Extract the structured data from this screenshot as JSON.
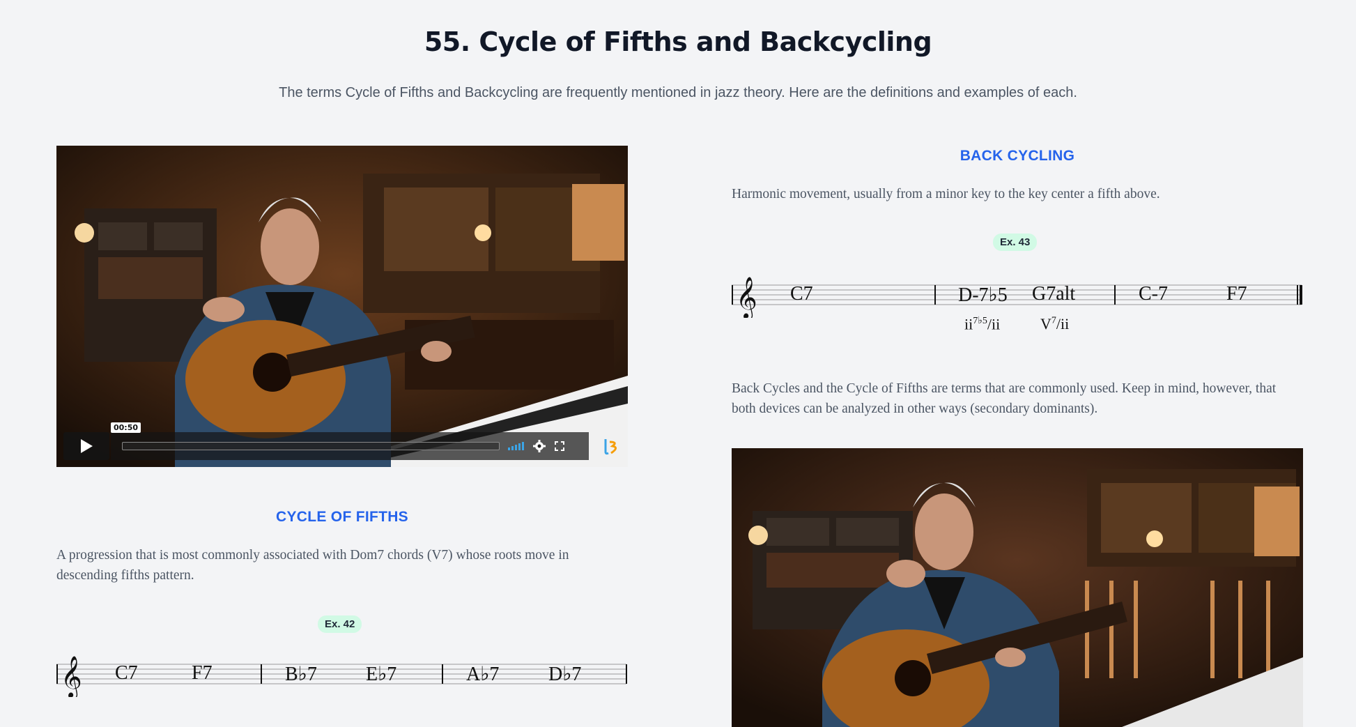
{
  "title": "55.  Cycle of Fifths and Backcycling",
  "subtitle": "The terms Cycle of Fifths and Backcycling are frequently mentioned in jazz theory. Here are the definitions and examples of each.",
  "video_left": {
    "time": "00:50",
    "icons": [
      "play-icon",
      "volume-icon",
      "gear-icon",
      "fullscreen-icon",
      "brand-logo-icon"
    ]
  },
  "cycle_of_fifths": {
    "heading": "CYCLE OF FIFTHS",
    "text": "A progression that is most commonly associated with Dom7 chords (V7) whose roots move in descending fifths pattern.",
    "example": "Ex. 42",
    "chords": [
      "C7",
      "F7",
      "B♭7",
      "E♭7",
      "A♭7",
      "D♭7"
    ]
  },
  "back_cycling": {
    "heading": "BACK CYCLING",
    "text": "Harmonic movement, usually from a minor key to the key center a fifth above.",
    "example": "Ex. 43",
    "chords": [
      "C7",
      "D-7♭5",
      "G7alt",
      "C-7",
      "F7"
    ],
    "roman_1_base": "ii",
    "roman_1_sup": "7♭5",
    "roman_1_tail": "/ii",
    "roman_2_base": "V",
    "roman_2_sup": "7",
    "roman_2_tail": "/ii",
    "note": "Back Cycles and the Cycle of Fifths are terms that are commonly used. Keep in mind, however, that both devices can be analyzed in other ways (secondary dominants)."
  },
  "colors": {
    "accent": "#2563eb",
    "badge_bg": "#d1fae5",
    "page_bg": "#f3f4f6"
  }
}
